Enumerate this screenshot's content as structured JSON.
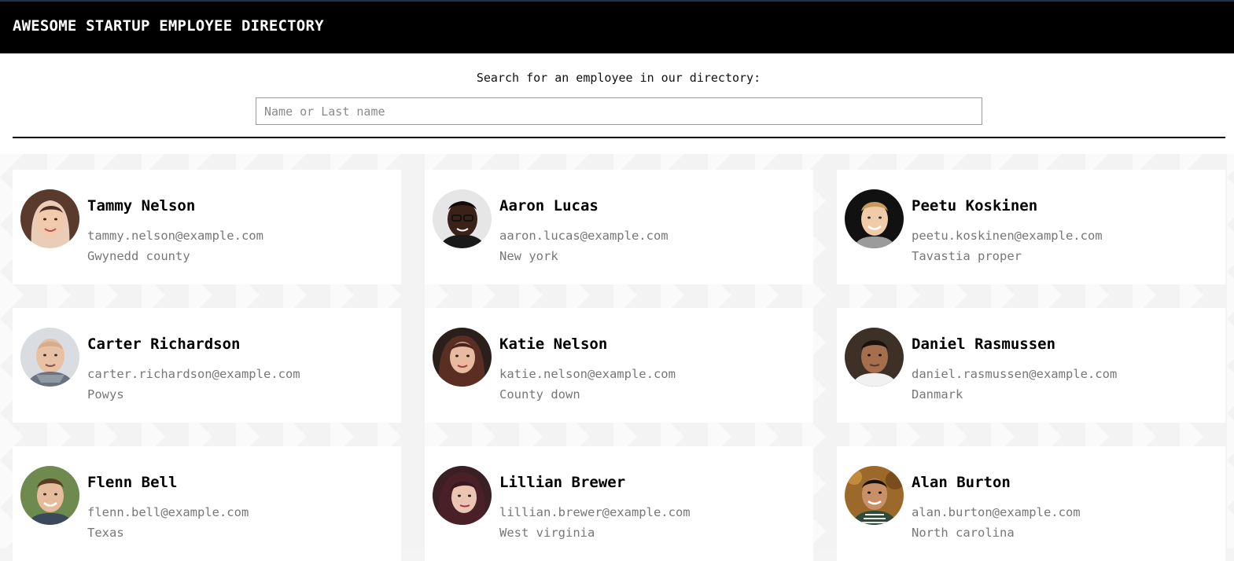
{
  "header": {
    "title": "AWESOME STARTUP EMPLOYEE DIRECTORY"
  },
  "search": {
    "label": "Search for an employee in our directory:",
    "placeholder": "Name or Last name",
    "value": ""
  },
  "colors": {
    "header_bg": "#000000",
    "header_text": "#ffffff",
    "card_bg": "#ffffff",
    "muted_text": "#777777",
    "page_bg": "#f3f3f3"
  },
  "employees": [
    {
      "name": "Tammy Nelson",
      "email": "tammy.nelson@example.com",
      "location": "Gwynedd county",
      "avatar": "avatar-photo"
    },
    {
      "name": "Aaron Lucas",
      "email": "aaron.lucas@example.com",
      "location": "New york",
      "avatar": "avatar-photo"
    },
    {
      "name": "Peetu Koskinen",
      "email": "peetu.koskinen@example.com",
      "location": "Tavastia proper",
      "avatar": "avatar-photo"
    },
    {
      "name": "Carter Richardson",
      "email": "carter.richardson@example.com",
      "location": "Powys",
      "avatar": "avatar-photo"
    },
    {
      "name": "Katie Nelson",
      "email": "katie.nelson@example.com",
      "location": "County down",
      "avatar": "avatar-photo"
    },
    {
      "name": "Daniel Rasmussen",
      "email": "daniel.rasmussen@example.com",
      "location": "Danmark",
      "avatar": "avatar-photo"
    },
    {
      "name": "Flenn Bell",
      "email": "flenn.bell@example.com",
      "location": "Texas",
      "avatar": "avatar-photo"
    },
    {
      "name": "Lillian Brewer",
      "email": "lillian.brewer@example.com",
      "location": "West virginia",
      "avatar": "avatar-photo"
    },
    {
      "name": "Alan Burton",
      "email": "alan.burton@example.com",
      "location": "North carolina",
      "avatar": "avatar-photo"
    }
  ]
}
